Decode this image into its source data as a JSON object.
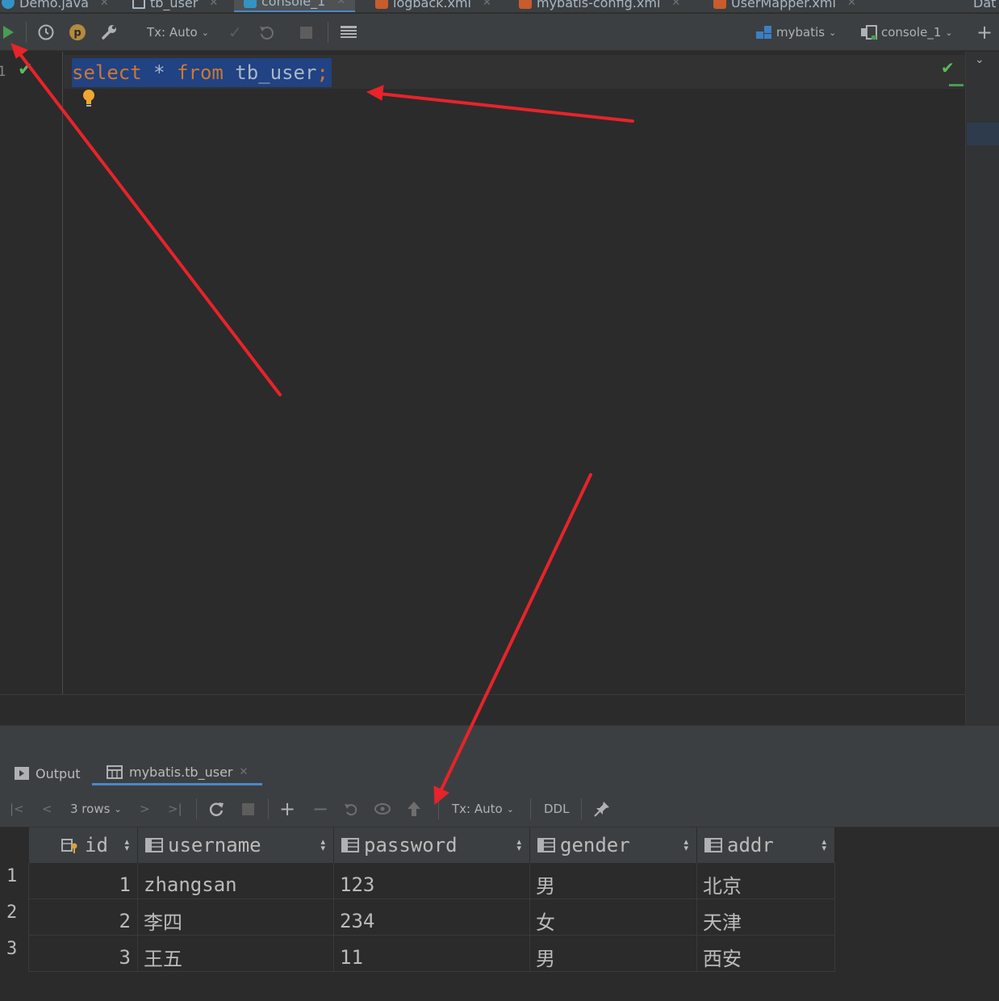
{
  "tabs": [
    {
      "label": "Demo.java",
      "icon": "java-class-icon",
      "color": "#3592c4"
    },
    {
      "label": "tb_user",
      "icon": "table-icon",
      "color": "#a9b7c6"
    },
    {
      "label": "console_1",
      "icon": "console-icon",
      "color": "#3592c4"
    },
    {
      "label": "logback.xml",
      "icon": "xml-file-icon",
      "color": "#c75c2e"
    },
    {
      "label": "mybatis-config.xml",
      "icon": "xml-file-icon",
      "color": "#c75c2e"
    },
    {
      "label": "UserMapper.xml",
      "icon": "xml-file-icon",
      "color": "#c75c2e"
    },
    {
      "label": "Dat",
      "icon": "",
      "color": ""
    }
  ],
  "toolbar": {
    "tx_mode": "Tx: Auto",
    "datasource": "mybatis",
    "console": "console_1",
    "add_label": "+"
  },
  "editor": {
    "line_number": "1",
    "code": {
      "kw1": "select",
      "star": " * ",
      "kw2": "from",
      "table": " tb_user",
      "semi": ";"
    }
  },
  "services": {
    "output_tab": "Output",
    "result_tab": "mybatis.tb_user"
  },
  "result_toolbar": {
    "rows": "3 rows",
    "tx_mode": "Tx: Auto",
    "ddl": "DDL"
  },
  "grid": {
    "columns": [
      "id",
      "username",
      "password",
      "gender",
      "addr"
    ],
    "rows": [
      {
        "n": "1",
        "id": "1",
        "username": "zhangsan",
        "password": "123",
        "gender": "男",
        "addr": "北京"
      },
      {
        "n": "2",
        "id": "2",
        "username": "李四",
        "password": "234",
        "gender": "女",
        "addr": "天津"
      },
      {
        "n": "3",
        "id": "3",
        "username": "王五",
        "password": "11",
        "gender": "男",
        "addr": "西安"
      }
    ]
  },
  "colors": {
    "annotation_arrow": "#e8232a",
    "selection": "#214283",
    "keyword": "#cc7832"
  }
}
